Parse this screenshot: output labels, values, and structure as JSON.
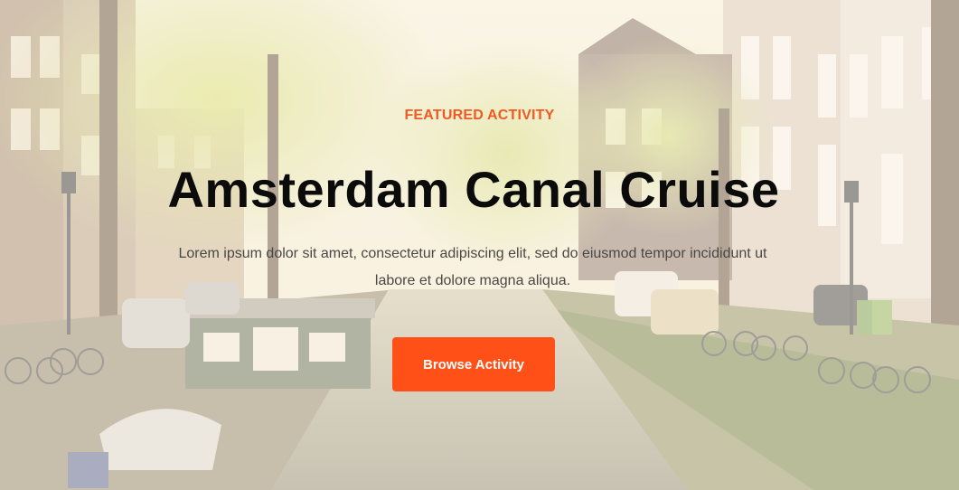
{
  "hero": {
    "eyebrow": "FEATURED ACTIVITY",
    "title": "Amsterdam Canal Cruise",
    "description": "Lorem ipsum dolor sit amet, consectetur adipiscing elit, sed do eiusmod tempor incididunt ut labore et dolore magna aliqua.",
    "cta_label": "Browse Activity"
  },
  "colors": {
    "accent": "#ff5117",
    "eyebrow": "#f05a22",
    "title": "#0b0b0b",
    "body_text": "#4a4744"
  }
}
